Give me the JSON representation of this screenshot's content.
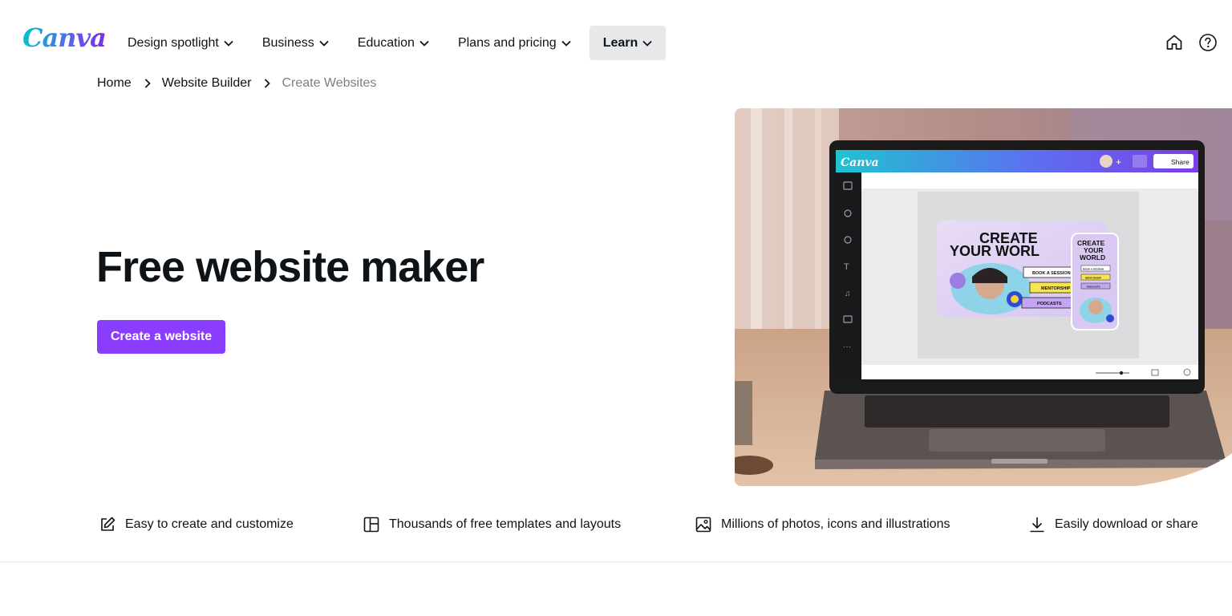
{
  "header": {
    "logo": "Canva",
    "nav": [
      {
        "label": "Design spotlight"
      },
      {
        "label": "Business"
      },
      {
        "label": "Education"
      },
      {
        "label": "Plans and pricing"
      },
      {
        "label": "Learn"
      }
    ],
    "icons": [
      "home-icon",
      "help-icon"
    ]
  },
  "breadcrumb": {
    "items": [
      "Home",
      "Website Builder",
      "Create Websites"
    ]
  },
  "hero": {
    "title": "Free website maker",
    "cta_label": "Create a website"
  },
  "mockup": {
    "app_logo": "Canva",
    "share_label": "Share",
    "headline_line1": "CREATE",
    "headline_line2": "YOUR WORL",
    "buttons": [
      "BOOK A SESSION",
      "MENTORSHIP",
      "PODCASTS"
    ],
    "phone_headline": [
      "CREATE",
      "YOUR",
      "WORLD"
    ],
    "phone_buttons": [
      "BOOK A SESSION",
      "MENTORSHIP",
      "PODCASTS"
    ]
  },
  "features": [
    {
      "icon": "pencil-edit-icon",
      "label": "Easy to create and customize"
    },
    {
      "icon": "layout-template-icon",
      "label": "Thousands of free templates and layouts"
    },
    {
      "icon": "image-icon",
      "label": "Millions of photos, icons and illustrations"
    },
    {
      "icon": "download-icon",
      "label": "Easily download or share"
    }
  ],
  "colors": {
    "accent": "#8b3dff",
    "text": "#0e1318",
    "muted": "#7a7f86",
    "nav_active_bg": "#e7e8ea"
  }
}
